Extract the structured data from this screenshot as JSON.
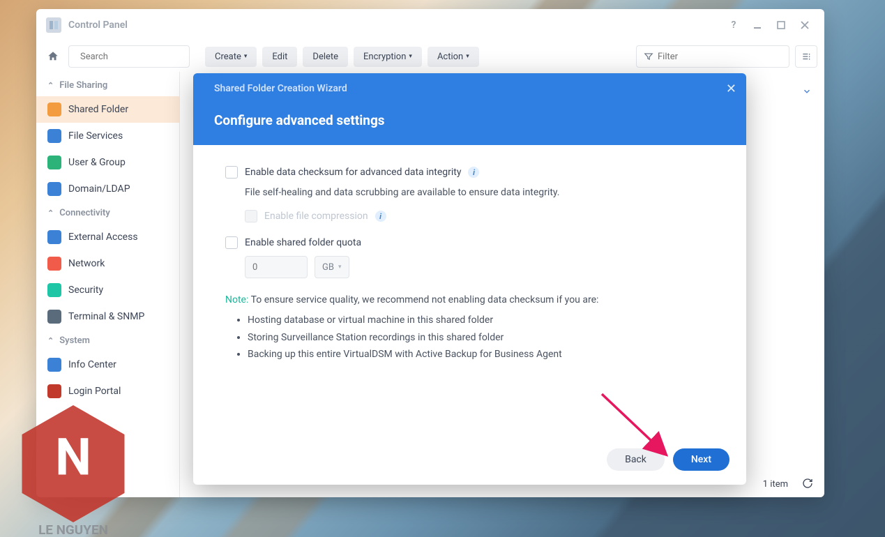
{
  "window": {
    "title": "Control Panel"
  },
  "search": {
    "placeholder": "Search"
  },
  "toolbar": {
    "create": "Create",
    "edit": "Edit",
    "delete": "Delete",
    "encryption": "Encryption",
    "action": "Action",
    "filter_placeholder": "Filter"
  },
  "sidebar": {
    "sections": [
      {
        "label": "File Sharing",
        "items": [
          {
            "label": "Shared Folder",
            "icon_color": "#f39c3f",
            "active": true
          },
          {
            "label": "File Services",
            "icon_color": "#3b82d6"
          },
          {
            "label": "User & Group",
            "icon_color": "#2cb37a"
          },
          {
            "label": "Domain/LDAP",
            "icon_color": "#3b82d6"
          }
        ]
      },
      {
        "label": "Connectivity",
        "items": [
          {
            "label": "External Access",
            "icon_color": "#3b82d6"
          },
          {
            "label": "Network",
            "icon_color": "#f15b4a"
          },
          {
            "label": "Security",
            "icon_color": "#1fc6a6"
          },
          {
            "label": "Terminal & SNMP",
            "icon_color": "#5a6b7c"
          }
        ]
      },
      {
        "label": "System",
        "items": [
          {
            "label": "Info Center",
            "icon_color": "#3b82d6"
          },
          {
            "label": "Login Portal",
            "icon_color": "#c0392b"
          }
        ]
      }
    ]
  },
  "footer": {
    "count": "1 item"
  },
  "modal": {
    "wizard_title": "Shared Folder Creation Wizard",
    "heading": "Configure advanced settings",
    "checksum_label": "Enable data checksum for advanced data integrity",
    "checksum_desc": "File self-healing and data scrubbing are available to ensure data integrity.",
    "compression_label": "Enable file compression",
    "quota_label": "Enable shared folder quota",
    "quota_value": "0",
    "quota_unit": "GB",
    "note_prefix": "Note:",
    "note_text": "To ensure service quality, we recommend not enabling data checksum if you are:",
    "bullets": [
      "Hosting database or virtual machine in this shared folder",
      "Storing Surveillance Station recordings in this shared folder",
      "Backing up this entire VirtualDSM with Active Backup for Business Agent"
    ],
    "back": "Back",
    "next": "Next"
  }
}
